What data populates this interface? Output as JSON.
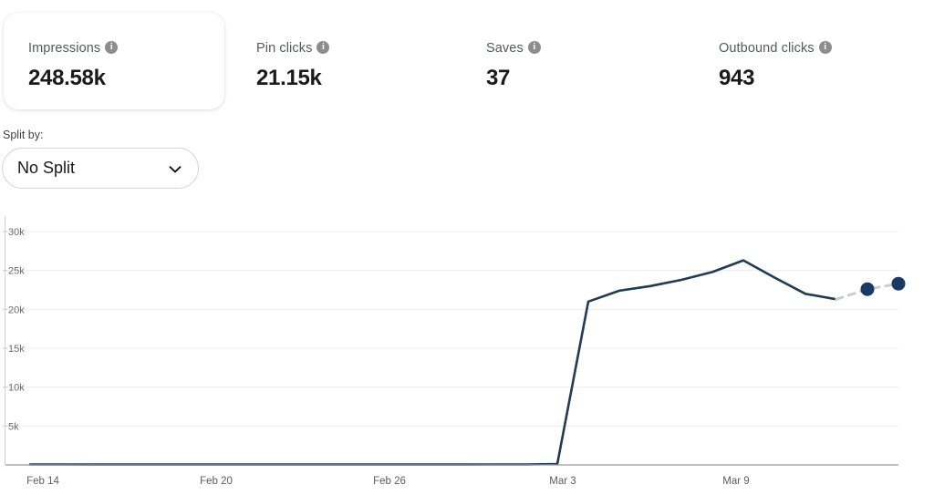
{
  "metrics": [
    {
      "label": "Impressions",
      "value": "248.58k",
      "icon": "info-icon",
      "carded": true
    },
    {
      "label": "Pin clicks",
      "value": "21.15k",
      "icon": "info-icon",
      "carded": false
    },
    {
      "label": "Saves",
      "value": "37",
      "icon": "info-icon",
      "carded": false
    },
    {
      "label": "Outbound clicks",
      "value": "943",
      "icon": "info-icon",
      "carded": false
    }
  ],
  "split": {
    "label": "Split by:",
    "selected": "No Split",
    "chevron_icon": "chevron-down-icon",
    "options": [
      "No Split"
    ]
  },
  "chart_data": {
    "type": "line",
    "title": "",
    "xlabel": "",
    "ylabel": "",
    "ylim": [
      0,
      32000
    ],
    "yticks": [
      5000,
      10000,
      15000,
      20000,
      25000,
      30000
    ],
    "ytick_labels": [
      "5k",
      "10k",
      "15k",
      "20k",
      "25k",
      "30k"
    ],
    "grid": true,
    "legend": "none",
    "line_color": "#1f3b55",
    "forecast_color": "#c9ccd1",
    "marker_color": "#1b3a63",
    "xtick_labels": [
      "Feb 14",
      "Feb 20",
      "Feb 26",
      "Mar 3",
      "Mar 9"
    ],
    "xtick_x": [
      47,
      237,
      427,
      617,
      807
    ],
    "x": [
      "Feb 14",
      "Feb 15",
      "Feb 16",
      "Feb 17",
      "Feb 18",
      "Feb 19",
      "Feb 20",
      "Feb 21",
      "Feb 22",
      "Feb 23",
      "Feb 24",
      "Feb 25",
      "Feb 26",
      "Feb 27",
      "Feb 28",
      "Mar 1",
      "Mar 2",
      "Mar 3",
      "Mar 4",
      "Mar 5",
      "Mar 6",
      "Mar 7",
      "Mar 8",
      "Mar 9",
      "Mar 10",
      "Mar 11",
      "Mar 12",
      "Mar 13",
      "Mar 14"
    ],
    "series": [
      {
        "name": "Impressions",
        "style": "solid",
        "values": [
          60,
          55,
          50,
          50,
          48,
          48,
          45,
          45,
          45,
          45,
          45,
          45,
          45,
          45,
          50,
          55,
          60,
          120,
          21000,
          22400,
          23000,
          23800,
          24800,
          26300,
          24100,
          22000,
          21300,
          null,
          null
        ]
      },
      {
        "name": "Impressions (incomplete)",
        "style": "dashed",
        "markers": true,
        "values": [
          null,
          null,
          null,
          null,
          null,
          null,
          null,
          null,
          null,
          null,
          null,
          null,
          null,
          null,
          null,
          null,
          null,
          null,
          null,
          null,
          null,
          null,
          null,
          null,
          null,
          null,
          21300,
          22600,
          23300
        ]
      }
    ]
  }
}
